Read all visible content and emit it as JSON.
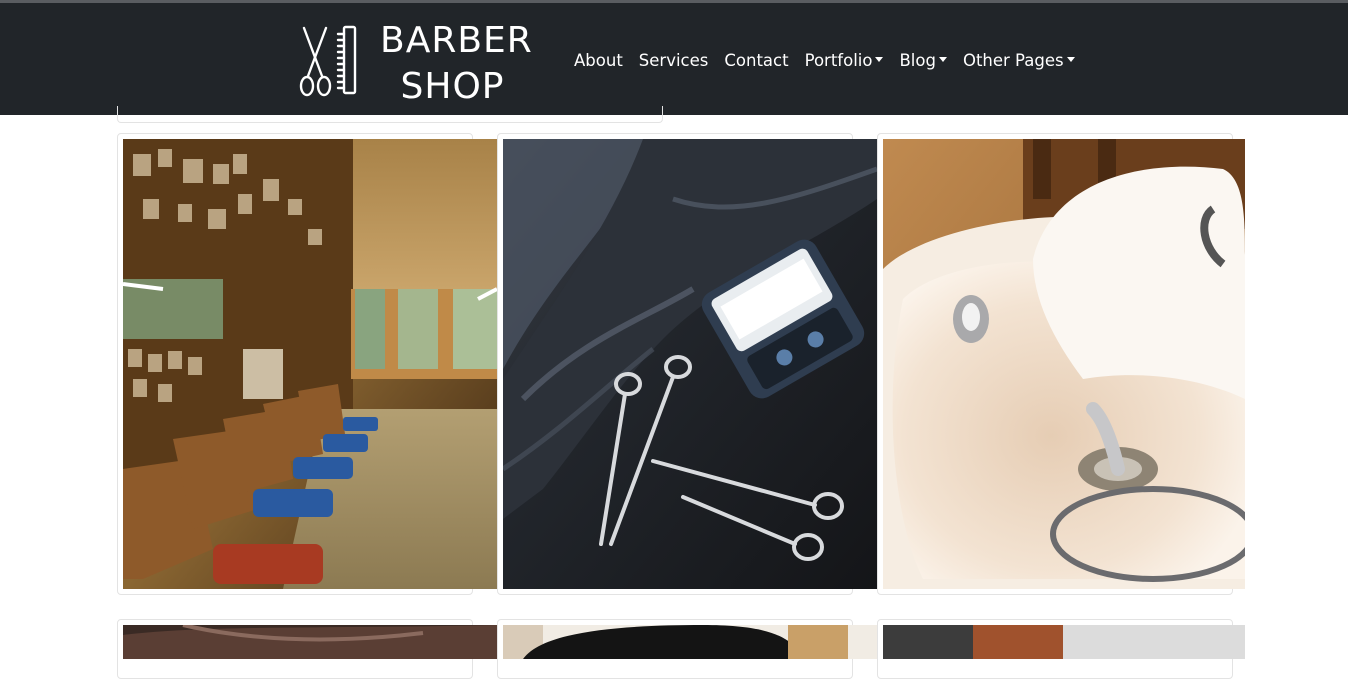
{
  "brand": {
    "line1": "BARBER",
    "line2": "SHOP",
    "icon": "scissors-comb-icon"
  },
  "nav": {
    "items": [
      {
        "label": "About",
        "dropdown": false
      },
      {
        "label": "Services",
        "dropdown": false
      },
      {
        "label": "Contact",
        "dropdown": false
      },
      {
        "label": "Portfolio",
        "dropdown": true
      },
      {
        "label": "Blog",
        "dropdown": true
      },
      {
        "label": "Other Pages",
        "dropdown": true
      }
    ]
  },
  "gallery": {
    "images": [
      "barbershop-interior-photo",
      "scissors-and-receipt-printer-photo",
      "shampoo-sink-photo",
      "barber-photo",
      "hat-photo",
      "salon-photo"
    ]
  },
  "colors": {
    "navbar_bg": "#212529",
    "nav_text": "#ffffff",
    "page_bg": "#ffffff",
    "card_border": "#e3e3e3"
  }
}
